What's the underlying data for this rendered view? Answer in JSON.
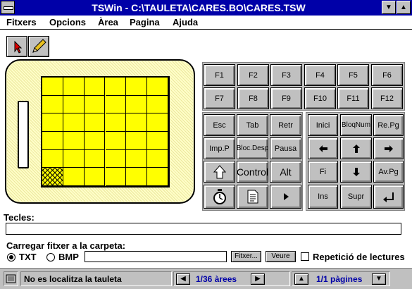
{
  "window": {
    "title": "TSWin - C:\\TAULETA\\CARES.BO\\CARES.TSW",
    "minimize": "▼",
    "maximize": "▲"
  },
  "menu": [
    "Fitxers",
    "Opcions",
    "Àrea",
    "Pagina",
    "Ajuda"
  ],
  "tools": [
    {
      "name": "pointer-tool",
      "icon": "arrow-pointer-icon",
      "color": "#e00000"
    },
    {
      "name": "pencil-tool",
      "icon": "pencil-icon",
      "color": "#e8c020"
    }
  ],
  "tablet": {
    "rows": 6,
    "cols": 6,
    "selected": {
      "row": 5,
      "col": 0
    },
    "grid_color": "#ffff00",
    "frame_color": "#fffec8"
  },
  "function_keys": [
    "F1",
    "F2",
    "F3",
    "F4",
    "F5",
    "F6",
    "F7",
    "F8",
    "F9",
    "F10",
    "F11",
    "F12"
  ],
  "left_keys": {
    "row1": [
      "Esc",
      "Tab",
      "Retr"
    ],
    "row2": [
      "Imp.P",
      "Bloc.Desp",
      "Pausa"
    ],
    "row3_shift_icon": "shift-arrow-icon",
    "row3": [
      "Control",
      "Alt"
    ],
    "row4_icons": [
      "stopwatch-icon",
      "document-icon",
      "play-right-icon"
    ]
  },
  "right_keys": {
    "row1": [
      "Inici",
      "BloqNum",
      "Re.Pg"
    ],
    "row2_icons": [
      "arrow-left-icon",
      "arrow-up-icon",
      "arrow-right-icon"
    ],
    "row3_labels": [
      "Fi",
      "Av.Pg"
    ],
    "row3_icon": "arrow-down-icon",
    "row4": [
      "Ins",
      "Supr"
    ],
    "row4_icon": "enter-icon"
  },
  "tecles": {
    "label": "Tecles:",
    "value": ""
  },
  "load": {
    "label": "Carregar fitxer a la carpeta:",
    "options": [
      "TXT",
      "BMP"
    ],
    "selected": "TXT",
    "path": "",
    "browse": "Fitxer...",
    "view": "Veure",
    "repeat_label": "Repetició de lectures",
    "repeat_checked": false
  },
  "status": {
    "message": "No es localitza la tauleta",
    "areas": "1/36 àrees",
    "pages": "1/1 pàgines"
  }
}
